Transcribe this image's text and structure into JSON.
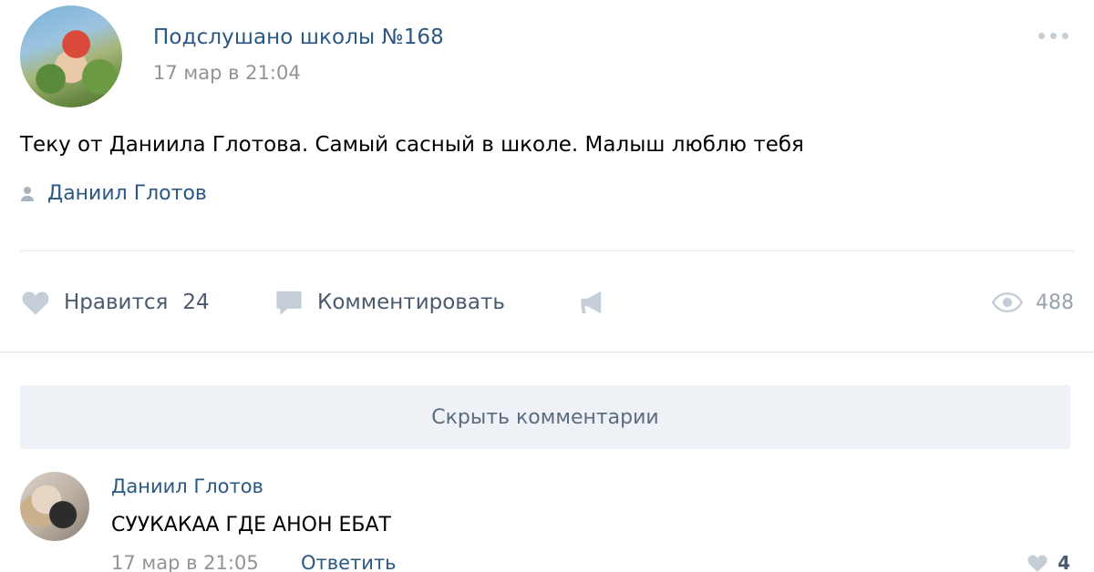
{
  "post": {
    "group_name": "Подслушано школы №168",
    "date": "17 мар в 21:04",
    "text": "Теку от Даниила Глотова. Самый сасный в школе. Малыш люблю тебя",
    "signer": "Даниил Глотов"
  },
  "actions": {
    "like_label": "Нравится",
    "like_count": "24",
    "comment_label": "Комментировать",
    "views_count": "488"
  },
  "comments_toggle": {
    "label": "Скрыть комментарии"
  },
  "comment": {
    "author": "Даниил Глотов",
    "text": "СУУКАКАА ГДЕ АНОН ЕБАТ",
    "date": "17 мар в 21:05",
    "reply_label": "Ответить",
    "like_count": "4"
  },
  "colors": {
    "link": "#2a5885",
    "muted": "#939393",
    "icon": "#c5cdd6",
    "button_bg": "#eef1f5"
  },
  "icons": [
    "more-icon",
    "person-icon",
    "heart-icon",
    "comment-icon",
    "share-icon",
    "eye-icon"
  ]
}
